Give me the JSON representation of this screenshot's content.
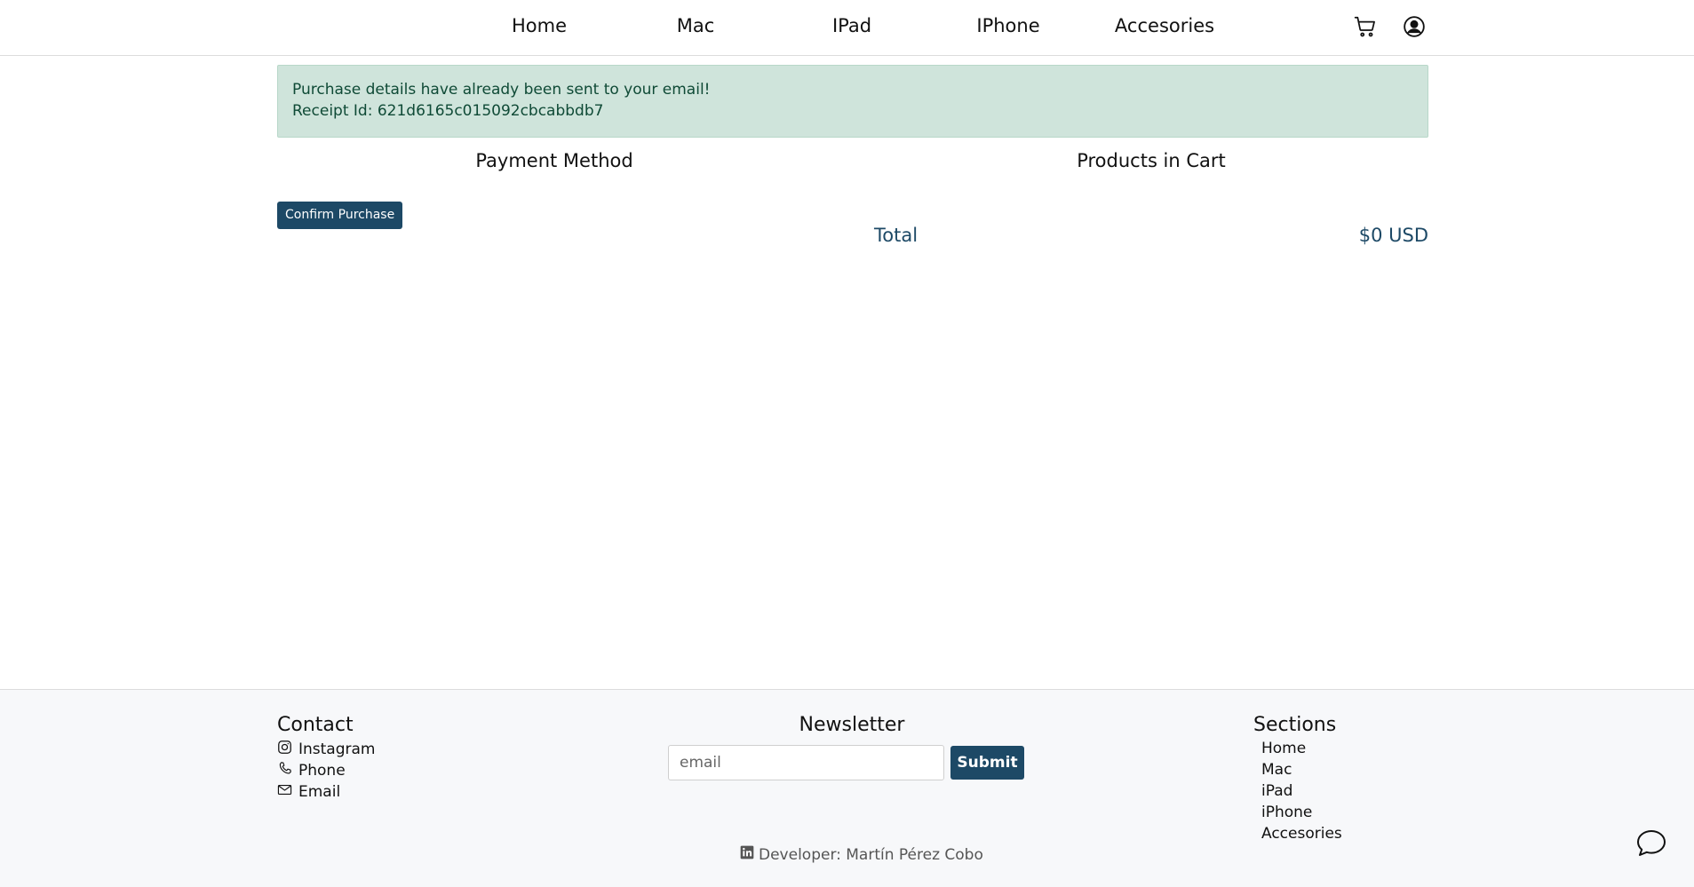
{
  "nav": {
    "links": [
      "Home",
      "Mac",
      "IPad",
      "IPhone",
      "Accesories"
    ],
    "icons": [
      "cart-icon",
      "user-circle-icon"
    ]
  },
  "alert": {
    "line1": "Purchase details have already been sent to your email!",
    "line2": "Receipt Id: 621d6165c015092cbcabbdb7"
  },
  "payment": {
    "title": "Payment Method",
    "confirm_label": "Confirm Purchase"
  },
  "cart": {
    "title": "Products in Cart",
    "total_label": "Total",
    "total_value": "$0 USD"
  },
  "footer": {
    "contact": {
      "heading": "Contact",
      "items": [
        {
          "label": "Instagram",
          "icon": "instagram-icon"
        },
        {
          "label": "Phone",
          "icon": "phone-icon"
        },
        {
          "label": "Email",
          "icon": "envelope-icon"
        }
      ]
    },
    "newsletter": {
      "heading": "Newsletter",
      "placeholder": "email",
      "submit_label": "Submit"
    },
    "sections": {
      "heading": "Sections",
      "links": [
        "Home",
        "Mac",
        "iPad",
        "iPhone",
        "Accesories"
      ]
    },
    "developer": {
      "label": "Developer: Martín Pérez Cobo",
      "icon": "linkedin-icon"
    },
    "chat_icon": "chat-bubble-icon"
  },
  "colors": {
    "primary": "#1d4966",
    "alert_bg": "#cfe4db",
    "alert_text": "#0f4a36",
    "footer_bg": "#f7f8fa"
  }
}
